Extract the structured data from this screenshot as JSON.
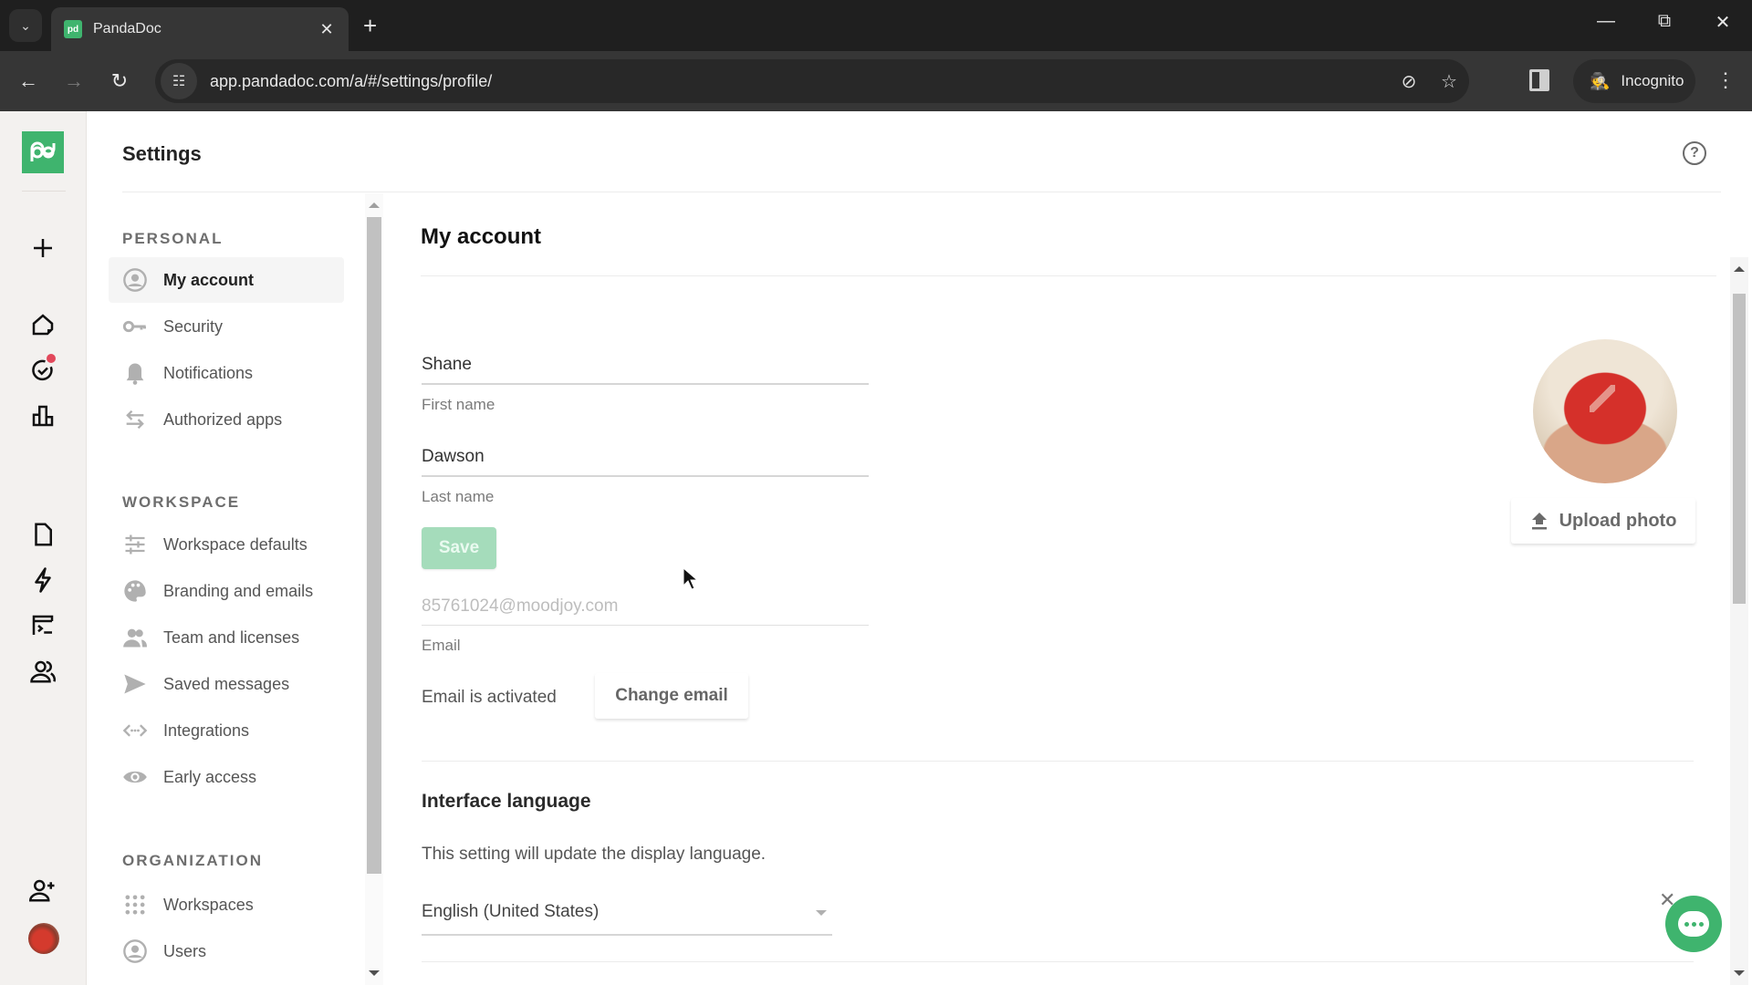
{
  "browser": {
    "tab_title": "PandaDoc",
    "url": "app.pandadoc.com/a/#/settings/profile/",
    "profile_label": "Incognito"
  },
  "app": {
    "header_title": "Settings",
    "rail": {
      "items": [
        "create-new",
        "home",
        "tasks",
        "reports",
        "documents",
        "automation",
        "templates",
        "contacts",
        "invite-user",
        "user-avatar"
      ],
      "tasks_has_notification": true
    },
    "sidebar": {
      "sections": [
        {
          "label": "PERSONAL",
          "items": [
            {
              "label": "My account",
              "icon": "user-circle-icon",
              "active": true
            },
            {
              "label": "Security",
              "icon": "key-icon"
            },
            {
              "label": "Notifications",
              "icon": "bell-icon"
            },
            {
              "label": "Authorized apps",
              "icon": "swap-arrows-icon"
            }
          ]
        },
        {
          "label": "WORKSPACE",
          "items": [
            {
              "label": "Workspace defaults",
              "icon": "sliders-icon"
            },
            {
              "label": "Branding and emails",
              "icon": "palette-icon"
            },
            {
              "label": "Team and licenses",
              "icon": "team-icon"
            },
            {
              "label": "Saved messages",
              "icon": "send-icon"
            },
            {
              "label": "Integrations",
              "icon": "code-icon"
            },
            {
              "label": "Early access",
              "icon": "eye-icon"
            }
          ]
        },
        {
          "label": "ORGANIZATION",
          "items": [
            {
              "label": "Workspaces",
              "icon": "grid-icon"
            },
            {
              "label": "Users",
              "icon": "user-circle-icon"
            }
          ]
        }
      ]
    },
    "main": {
      "title": "My account",
      "first_name": {
        "value": "Shane",
        "label": "First name"
      },
      "last_name": {
        "value": "Dawson",
        "label": "Last name"
      },
      "save_label": "Save",
      "email": {
        "value": "85761024@moodjoy.com",
        "label": "Email"
      },
      "email_status": "Email is activated",
      "change_email_label": "Change email",
      "upload_photo_label": "Upload photo",
      "language": {
        "title": "Interface language",
        "description": "This setting will update the display language.",
        "selected": "English (United States)"
      }
    },
    "colors": {
      "brand": "#3fb46e",
      "save_disabled": "#a5dcbb",
      "notification_dot": "#e2485b"
    }
  }
}
